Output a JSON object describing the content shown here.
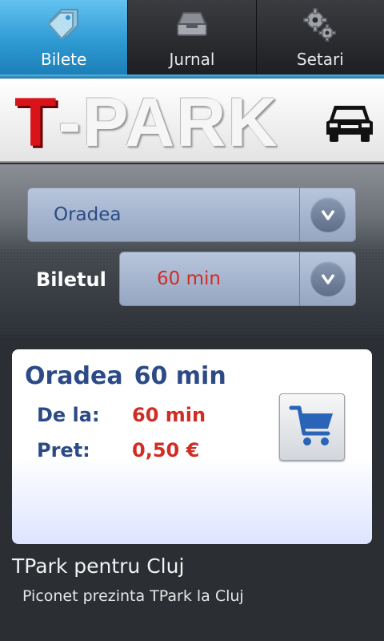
{
  "tabs": [
    {
      "label": "Bilete",
      "icon": "ticket-tag-icon",
      "active": true
    },
    {
      "label": "Jurnal",
      "icon": "inbox-tray-icon",
      "active": false
    },
    {
      "label": "Setari",
      "icon": "gears-icon",
      "active": false
    }
  ],
  "header": {
    "logo_first": "T",
    "logo_rest": "-PARK",
    "car_icon": "car-icon"
  },
  "selectors": {
    "city_value": "Oradea",
    "ticket_label": "Biletul",
    "ticket_value": "60 min",
    "dropdown_icon": "chevron-down-icon"
  },
  "card": {
    "city": "Oradea",
    "duration": "60 min",
    "from_label": "De la:",
    "from_value": "60 min",
    "price_label": "Pret:",
    "price_value": "0,50 €",
    "cart_icon": "shopping-cart-icon"
  },
  "footer": {
    "title": "TPark pentru Cluj",
    "subtitle": "Piconet prezinta TPark la Cluj"
  },
  "colors": {
    "accent_blue": "#2f9ad3",
    "title_blue": "#2b4a86",
    "price_red": "#d02d24",
    "logo_red": "#d8141a"
  }
}
